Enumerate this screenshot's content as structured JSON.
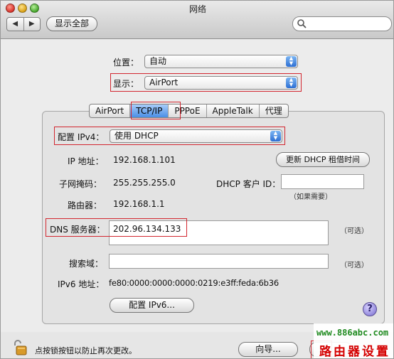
{
  "window": {
    "title": "网络"
  },
  "toolbar": {
    "back_glyph": "◀",
    "forward_glyph": "▶",
    "show_all_label": "显示全部",
    "search_placeholder": ""
  },
  "location": {
    "label": "位置：",
    "value": "自动"
  },
  "show": {
    "label": "显示：",
    "value": "AirPort"
  },
  "tabs": [
    {
      "label": "AirPort",
      "active": false
    },
    {
      "label": "TCP/IP",
      "active": true
    },
    {
      "label": "PPPoE",
      "active": false
    },
    {
      "label": "AppleTalk",
      "active": false
    },
    {
      "label": "代理",
      "active": false
    }
  ],
  "ipv4_config": {
    "label": "配置 IPv4：",
    "value": "使用 DHCP"
  },
  "ip_address": {
    "label": "IP 地址：",
    "value": "192.168.1.101"
  },
  "renew_dhcp_label": "更新 DHCP 租借时间",
  "subnet_mask": {
    "label": "子网掩码：",
    "value": "255.255.255.0"
  },
  "dhcp_client_id": {
    "label": "DHCP 客户 ID：",
    "value": "",
    "hint": "（如果需要）"
  },
  "router": {
    "label": "路由器：",
    "value": "192.168.1.1"
  },
  "dns_servers": {
    "label": "DNS 服务器：",
    "value": "202.96.134.133",
    "hint": "（可选）"
  },
  "search_domains": {
    "label": "搜索域：",
    "value": "",
    "hint": "（可选）"
  },
  "ipv6_address": {
    "label": "IPv6 地址：",
    "value": "fe80:0000:0000:0000:0219:e3ff:feda:6b36"
  },
  "configure_ipv6_label": "配置 IPv6...",
  "help_label": "?",
  "lock_text": "点按锁按钮以防止再次更改。",
  "assist_label": "向导...",
  "watermark": {
    "url": "www.886abc.com",
    "text": "路由器设置"
  },
  "colors": {
    "highlight_box": "#d2262f",
    "accent": "#2d6fd3"
  }
}
